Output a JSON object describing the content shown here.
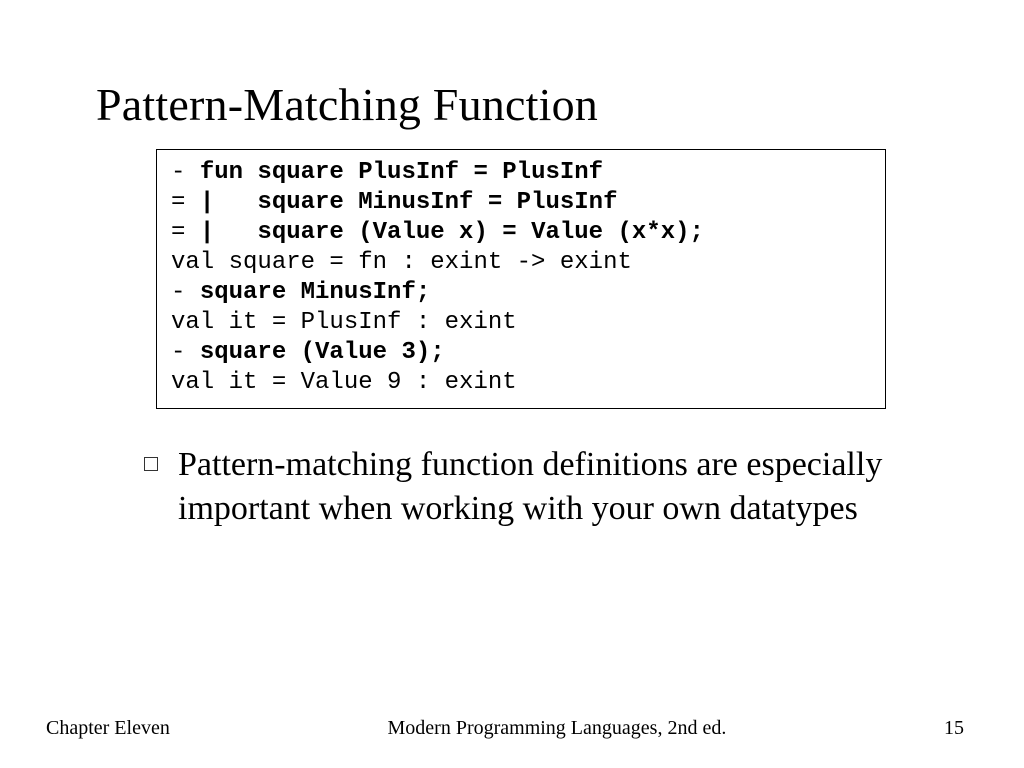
{
  "slide": {
    "title": "Pattern-Matching Function",
    "code": {
      "lines": [
        {
          "prefix": "- ",
          "bold": "fun square PlusInf = PlusInf"
        },
        {
          "prefix": "= ",
          "bold": "|   square MinusInf = PlusInf"
        },
        {
          "prefix": "= ",
          "bold": "|   square (Value x) = Value (x*x);"
        },
        {
          "plain": "val square = fn : exint -> exint"
        },
        {
          "prefix": "- ",
          "bold": "square MinusInf;"
        },
        {
          "plain": "val it = PlusInf : exint"
        },
        {
          "prefix": "- ",
          "bold": "square (Value 3);"
        },
        {
          "plain": "val it = Value 9 : exint"
        }
      ]
    },
    "bullets": [
      "Pattern-matching function definitions are especially important when working with your own datatypes"
    ],
    "footer": {
      "left": "Chapter Eleven",
      "center": "Modern Programming Languages, 2nd ed.",
      "right": "15"
    }
  }
}
